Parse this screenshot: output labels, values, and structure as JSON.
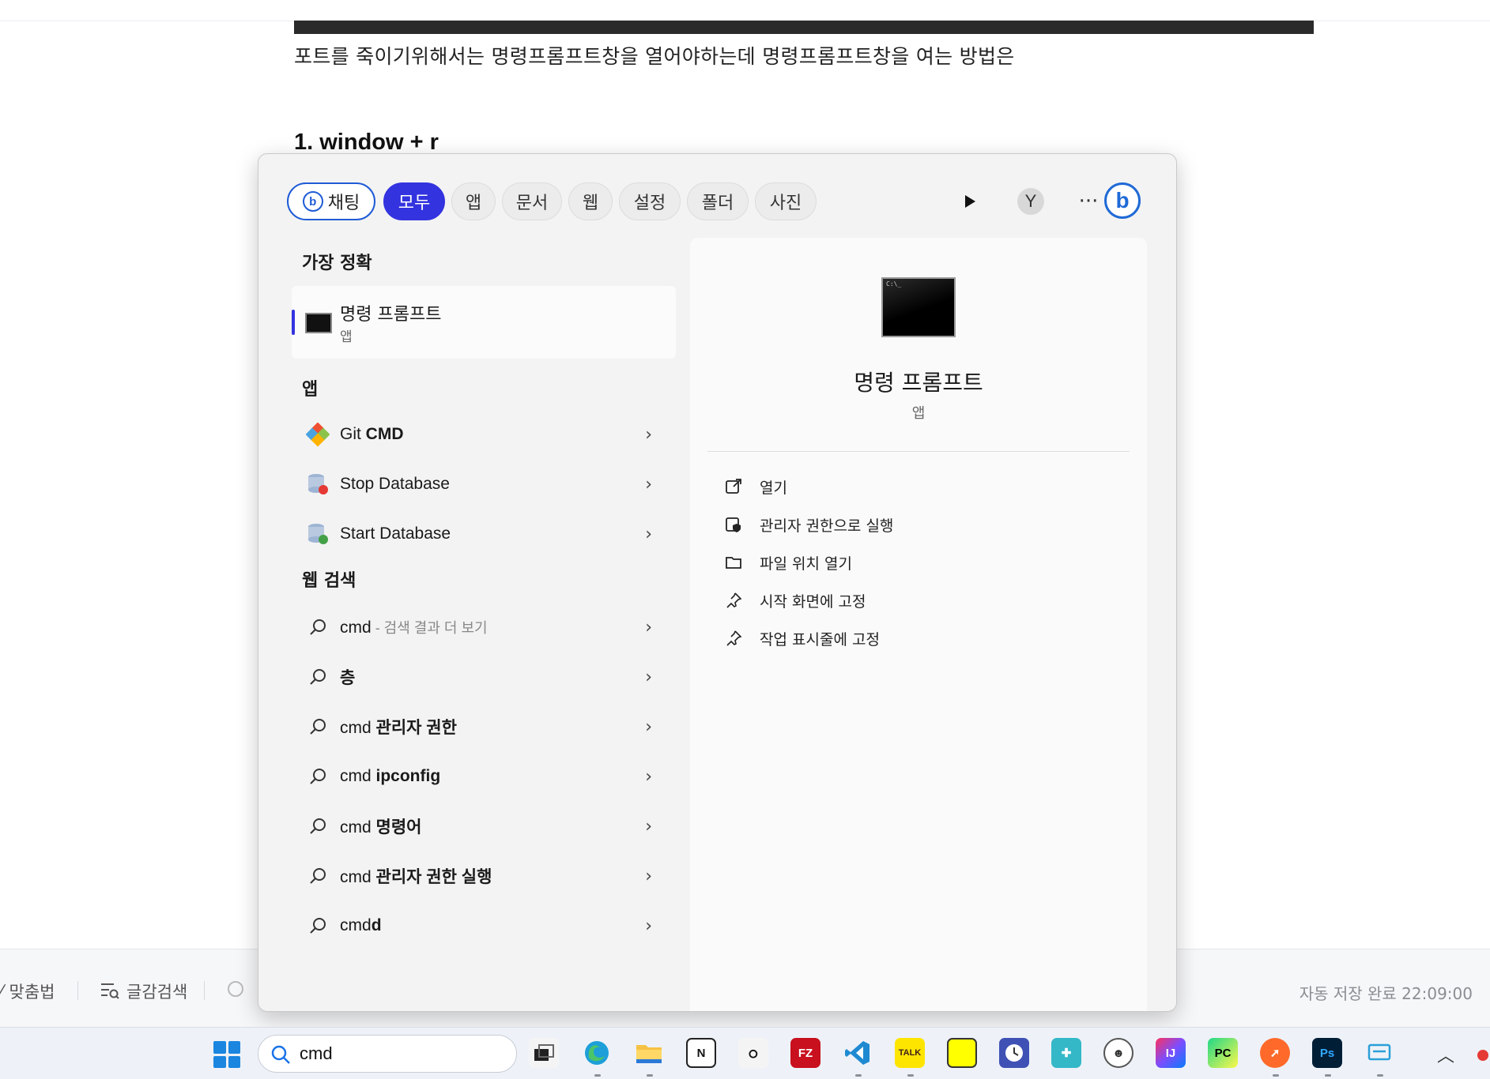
{
  "document": {
    "paragraph": "포트를 죽이기위해서는 명령프롬프트창을 열어야하는데 명령프롬프트창을 여는 방법은",
    "heading": "1.  window + r"
  },
  "editor_bar": {
    "spellcheck": "맞춤법",
    "char_search": "글감검색",
    "autosave": "자동 저장 완료 22:09:00"
  },
  "flyout": {
    "tabs": {
      "chat": "채팅",
      "all": "모두",
      "apps": "앱",
      "docs": "문서",
      "web": "웹",
      "settings": "설정",
      "folders": "폴더",
      "photos": "사진"
    },
    "avatar_letter": "Y",
    "more": "···",
    "best_match_title": "가장 정확",
    "best_match": {
      "name": "명령 프롬프트",
      "type": "앱"
    },
    "apps_title": "앱",
    "apps": [
      {
        "pre": "Git ",
        "bold": "CMD"
      },
      {
        "pre": "Stop Database",
        "bold": ""
      },
      {
        "pre": "Start Database",
        "bold": ""
      }
    ],
    "web_title": "웹 검색",
    "web": [
      {
        "pre": "cmd",
        "bold": "",
        "hint": " - 검색 결과 더 보기"
      },
      {
        "pre": "",
        "bold": "층",
        "hint": ""
      },
      {
        "pre": "cmd ",
        "bold": "관리자 권한",
        "hint": ""
      },
      {
        "pre": "cmd ",
        "bold": "ipconfig",
        "hint": ""
      },
      {
        "pre": "cmd ",
        "bold": "명령어",
        "hint": ""
      },
      {
        "pre": "cmd ",
        "bold": "관리자 권한 실행",
        "hint": ""
      },
      {
        "pre": "cmd",
        "bold": "d",
        "hint": ""
      }
    ],
    "preview": {
      "name": "명령 프롬프트",
      "type": "앱",
      "actions": [
        "열기",
        "관리자 권한으로 실행",
        "파일 위치 열기",
        "시작 화면에 고정",
        "작업 표시줄에 고정"
      ]
    }
  },
  "taskbar": {
    "search_value": "cmd"
  }
}
